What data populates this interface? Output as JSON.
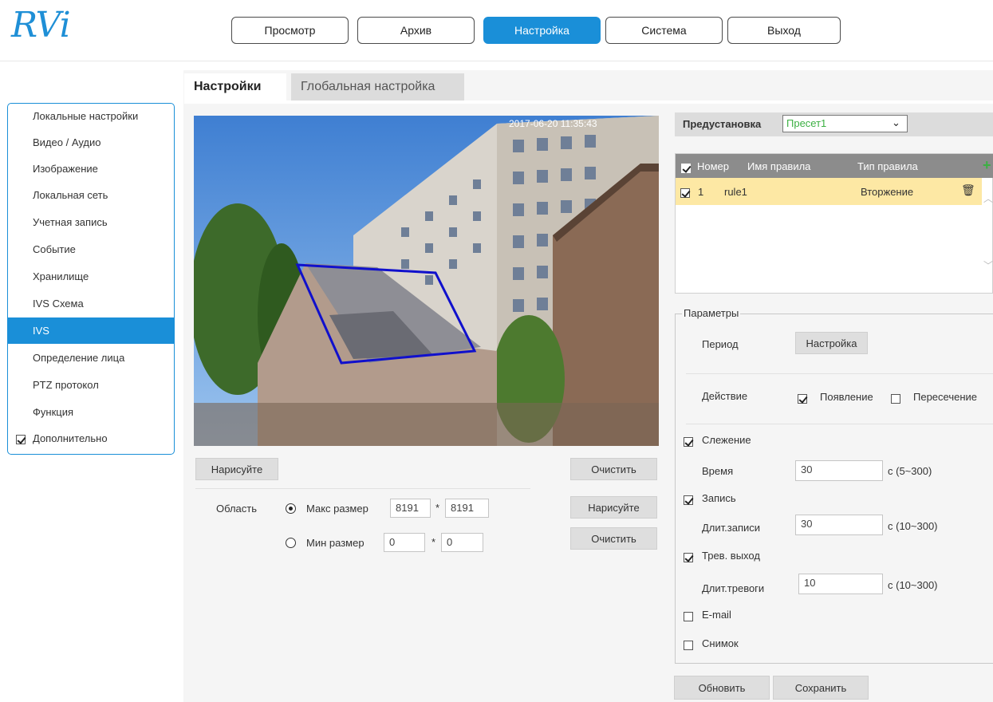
{
  "logo": {
    "text": "RVi"
  },
  "nav": {
    "items": [
      {
        "label": "Просмотр"
      },
      {
        "label": "Архив"
      },
      {
        "label": "Настройка"
      },
      {
        "label": "Система"
      },
      {
        "label": "Выход"
      }
    ],
    "active_index": 2
  },
  "sidebar": {
    "items": [
      {
        "label": "Локальные настройки"
      },
      {
        "label": "Видео / Аудио"
      },
      {
        "label": "Изображение"
      },
      {
        "label": "Локальная сеть"
      },
      {
        "label": "Учетная запись"
      },
      {
        "label": "Событие"
      },
      {
        "label": "Хранилище"
      },
      {
        "label": "IVS Схема"
      },
      {
        "label": "IVS"
      },
      {
        "label": "Определение лица"
      },
      {
        "label": "PTZ протокол"
      },
      {
        "label": "Функция"
      }
    ],
    "active_index": 8,
    "advanced_label": "Дополнительно",
    "advanced_checked": true
  },
  "tabs": {
    "settings": "Настройки",
    "global": "Глобальная настройка"
  },
  "video": {
    "timestamp": "2017-06-20 11:35:43"
  },
  "drawing": {
    "draw_label": "Нарисуйте",
    "clear_label": "Очистить",
    "area_label": "Область",
    "max_size_label": "Макс размер",
    "min_size_label": "Мин размер",
    "max_w": "8191",
    "max_h": "8191",
    "min_w": "0",
    "min_h": "0",
    "times": "*",
    "draw2_label": "Нарисуйте",
    "clear2_label": "Очистить",
    "max_selected": true
  },
  "preset": {
    "label": "Предустановка",
    "value": "Пресет1"
  },
  "rules": {
    "headers": {
      "number": "Номер",
      "name": "Имя правила",
      "type": "Тип правила"
    },
    "rows": [
      {
        "number": "1",
        "name": "rule1",
        "type": "Вторжение",
        "checked": true
      }
    ]
  },
  "params": {
    "legend": "Параметры",
    "period_label": "Период",
    "period_button": "Настройка",
    "action_label": "Действие",
    "appear_label": "Появление",
    "appear_checked": true,
    "cross_label": "Пересечение",
    "cross_checked": false,
    "tracking_label": "Слежение",
    "tracking_checked": true,
    "time_label": "Время",
    "time_value": "30",
    "time_range": "с (5~300)",
    "record_label": "Запись",
    "record_checked": true,
    "record_dur_label": "Длит.записи",
    "record_dur_value": "30",
    "record_range": "с (10~300)",
    "alarm_label": "Трев. выход",
    "alarm_checked": true,
    "alarm_dur_label": "Длит.тревоги",
    "alarm_dur_value": "10",
    "alarm_range": "с (10~300)",
    "email_label": "E-mail",
    "email_checked": false,
    "snapshot_label": "Снимок",
    "snapshot_checked": false
  },
  "footer": {
    "refresh_label": "Обновить",
    "save_label": "Сохранить"
  },
  "colors": {
    "accent": "#1a8fd8",
    "rule_row": "#fde8a4",
    "header_gray": "#8c8c8c",
    "add_icon": "#3cb043",
    "region": "#1010cc"
  }
}
